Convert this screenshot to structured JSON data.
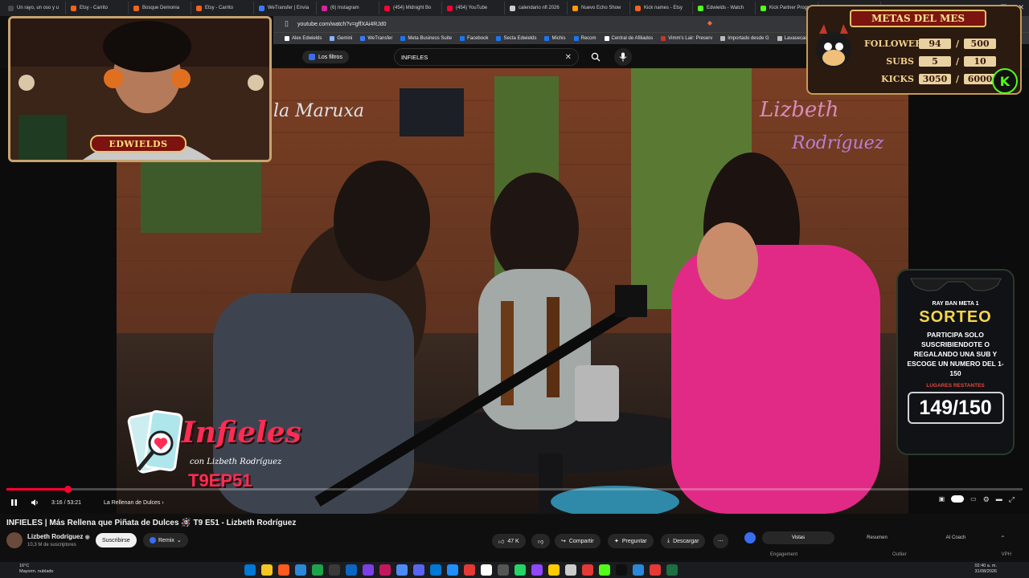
{
  "browser": {
    "tabs": [
      {
        "label": "Un rayo, un oso y u",
        "color": "#4a4a4a"
      },
      {
        "label": "Etsy - Carrito",
        "color": "#f1641e"
      },
      {
        "label": "Bosque Demonia",
        "color": "#f1641e"
      },
      {
        "label": "Etsy - Carrito",
        "color": "#f1641e"
      },
      {
        "label": "WeTransfer | Envía",
        "color": "#3a7bfd"
      },
      {
        "label": "(6) Instagram",
        "color": "#d6249f"
      },
      {
        "label": "(454) Midnight Bo",
        "color": "#ff0033"
      },
      {
        "label": "(454) YouTube",
        "color": "#ff0033"
      },
      {
        "label": "calendario nfl 2026",
        "color": "#cccccc"
      },
      {
        "label": "Nuevo Echo Show",
        "color": "#ff9900"
      },
      {
        "label": "Kick names - Etsy",
        "color": "#f1641e"
      },
      {
        "label": "Edwields - Watch",
        "color": "#53fc18"
      },
      {
        "label": "Kick Partner Progr",
        "color": "#53fc18"
      },
      {
        "label": "Community Guid",
        "color": "#53fc18"
      }
    ],
    "url": "youtube.com/watch?v=gffXAi4RJd0",
    "bookmarks": [
      {
        "label": "Alex Edwields",
        "color": "#ffffff"
      },
      {
        "label": "Gemini",
        "color": "#8ab4f8"
      },
      {
        "label": "WeTransfer",
        "color": "#3a7bfd"
      },
      {
        "label": "Meta Business Suite",
        "color": "#1877f2"
      },
      {
        "label": "Facebook",
        "color": "#1877f2"
      },
      {
        "label": "Secta Edwields",
        "color": "#1877f2"
      },
      {
        "label": "Michis",
        "color": "#1877f2"
      },
      {
        "label": "Recom",
        "color": "#1877f2"
      },
      {
        "label": "Central de Afiliados",
        "color": "#ffffff"
      },
      {
        "label": "Vimm's Lair: Preserv",
        "color": "#c0392b"
      },
      {
        "label": "Importado desde G",
        "color": "#bbbbbb"
      },
      {
        "label": "Lavasecad",
        "color": "#bbbbbb"
      }
    ]
  },
  "youtube": {
    "filters_label": "Los filtros",
    "search_value": "INFIELES"
  },
  "overlays": {
    "cam_label": "EDWIELDS",
    "metas": {
      "title": "METAS DEL MES",
      "rows": [
        {
          "label": "FOLLOWERS",
          "current": "94",
          "goal": "500"
        },
        {
          "label": "SUBS",
          "current": "5",
          "goal": "10"
        },
        {
          "label": "KICKS",
          "current": "3050",
          "goal": "6000"
        }
      ]
    },
    "sorteo": {
      "top": "RAY BAN META 1",
      "title": "SORTEO",
      "desc": "PARTICIPA SOLO SUSCRIBIENDOTE O REGALANDO UNA SUB Y ESCOGE UN NUMERO DEL 1-150",
      "remaining_label": "LUGARES RESTANTES",
      "count": "149/150"
    },
    "show": {
      "name": "Infieles",
      "sub": "con Lizbeth Rodríguez",
      "episode": "T9EP51"
    }
  },
  "player": {
    "progress": 0.06,
    "time": "3:16 / 53:21",
    "chapter": "La Rellenan de Dulces"
  },
  "video": {
    "title": "INFIELES | Más Rellena que Piñata de Dulces 🪅 T9 E51 - Lizbeth Rodríguez",
    "channel": "Lizbeth Rodríguez",
    "subscribers": "10,3 M de suscriptores",
    "subscribe_label": "Suscribirse",
    "remix_label": "Remix",
    "likes": "47 K",
    "share_label": "Compartir",
    "ask_label": "Preguntar",
    "download_label": "Descargar"
  },
  "panel": {
    "tabs": [
      "Vistas",
      "Resumen",
      "AI Coach"
    ],
    "columns": [
      "Engagement",
      "Outlier",
      "VPH"
    ]
  },
  "taskbar": {
    "temp": "16°C",
    "weather": "Mayorm. nublado",
    "time": "02:40 a. m.",
    "date": "31/08/2026",
    "icons": [
      "#0078d4",
      "#f3c623",
      "#ff5a1f",
      "#2b88d8",
      "#1ea34a",
      "#3a3a3a",
      "#0a66c2",
      "#7b3fe4",
      "#c2185b",
      "#4c8bf5",
      "#5865f2",
      "#0078d4",
      "#1e90ff",
      "#e53935",
      "#ffffff",
      "#555555",
      "#25d366",
      "#9146ff",
      "#ffcc00",
      "#cccccc",
      "#e53935",
      "#53fc18",
      "#0f0f0f",
      "#2b88d8",
      "#e53935",
      "#1d6f42"
    ]
  }
}
